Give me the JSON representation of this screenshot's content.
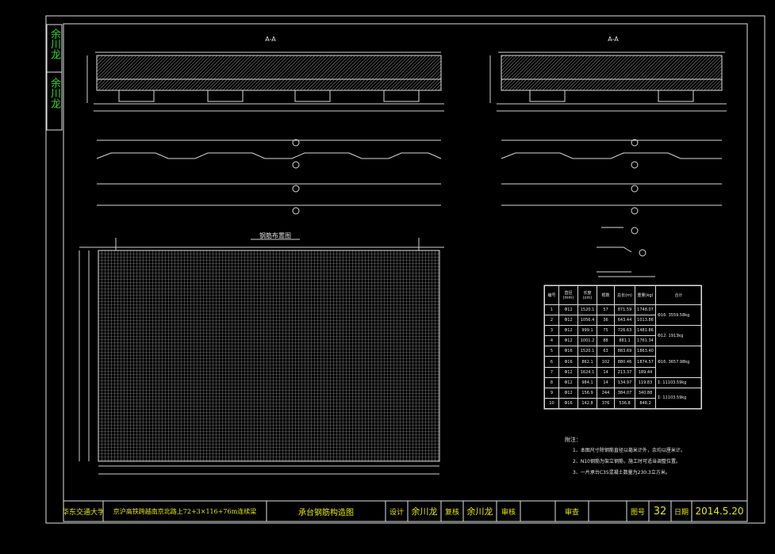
{
  "side_stamp": {
    "name_top": "余川龙",
    "name_mid": "余川龙"
  },
  "views": {
    "left_section_title": "A-A",
    "right_section_title": "A-A",
    "plan_title": "钢筋布置图"
  },
  "rebar_table": {
    "headers": [
      "编号",
      "直径(mm)",
      "长度(cm)",
      "根数",
      "总长(m)",
      "重量(kg)",
      "合计"
    ],
    "rows": [
      [
        "1",
        "Φ12",
        "1520.1",
        "57",
        "871.59",
        "1748.07"
      ],
      [
        "2",
        "Φ12",
        "1056.4",
        "36",
        "643.44",
        "1013.86"
      ],
      [
        "3",
        "Φ12",
        "999.1",
        "75",
        "726.63",
        "1481.86"
      ],
      [
        "4",
        "Φ12",
        "1001.2",
        "88",
        "881.1",
        "1761.34"
      ],
      [
        "5",
        "Φ16",
        "1520.1",
        "63",
        "883.69",
        "1863.40"
      ],
      [
        "6",
        "Φ16",
        "862.1",
        "102",
        "880.46",
        "1874.57"
      ],
      [
        "7",
        "Φ12",
        "1624.1",
        "14",
        "213.37",
        "189.44"
      ],
      [
        "8",
        "Φ12",
        "984.1",
        "14",
        "134.97",
        "119.83"
      ],
      [
        "9",
        "Φ12",
        "156.9",
        "244",
        "384.07",
        "340.88"
      ],
      [
        "10",
        "Φ16",
        "142.8",
        "376",
        "536.8",
        "848.2"
      ]
    ],
    "totals": [
      "Φ16: 3559.58kg",
      "Φ12: 1913kg",
      "Φ16: 3657.98kg",
      "Σ: 11103.59kg",
      "Σ: 11103.59kg"
    ]
  },
  "notes": {
    "title": "附注：",
    "items": [
      "1、本图尺寸除钢筋直径以毫米计外，余均以厘米计。",
      "2、N10钢筋为架立钢筋，施工时可适当调整位置。",
      "3、一片承台C35混凝土数量为230.3立方米。"
    ]
  },
  "title_block": {
    "school": "华东交通大学",
    "project": "京沪高铁跨越南京北路上72+3×116+76m连续梁",
    "drawing_title": "承台钢筋构造图",
    "design_label": "设计",
    "designer": "余川龙",
    "check_label": "复核",
    "checker": "余川龙",
    "review_label": "审核",
    "approve_label": "审查",
    "sheet_label": "图号",
    "sheet_no": "32",
    "date_label": "日期",
    "date": "2014.5.20"
  }
}
